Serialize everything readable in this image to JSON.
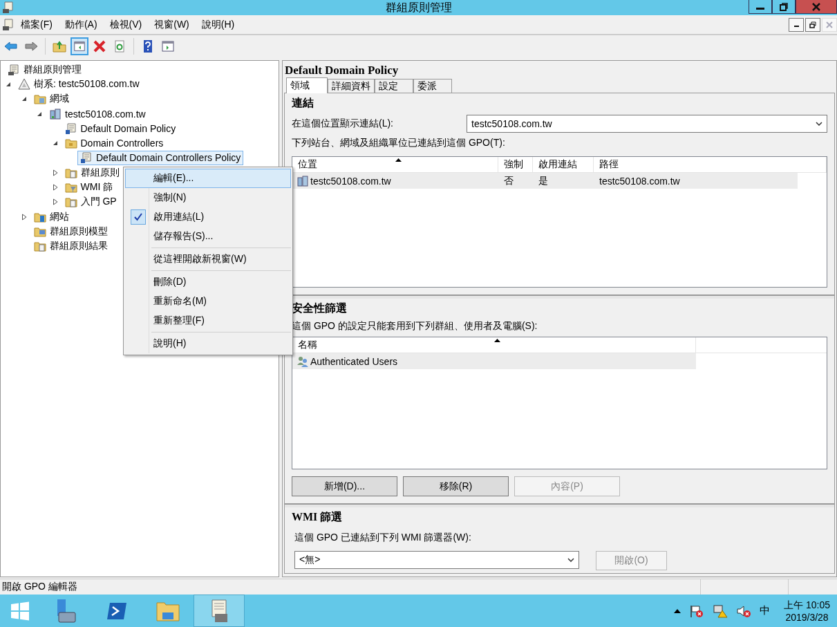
{
  "window": {
    "title": "群組原則管理"
  },
  "menu": [
    "檔案(F)",
    "動作(A)",
    "檢視(V)",
    "視窗(W)",
    "說明(H)"
  ],
  "toolbar": [
    {
      "kind": "back",
      "selected": false
    },
    {
      "kind": "forward",
      "selected": false
    },
    {
      "kind": "separator"
    },
    {
      "kind": "up",
      "selected": false
    },
    {
      "kind": "tree",
      "selected": true
    },
    {
      "kind": "delete",
      "selected": false
    },
    {
      "kind": "refresh",
      "selected": false
    },
    {
      "kind": "separator"
    },
    {
      "kind": "help",
      "selected": false
    },
    {
      "kind": "pane",
      "selected": false
    }
  ],
  "tree": [
    {
      "label": "群組原則管理",
      "kind": "root",
      "selected": false,
      "children": [
        {
          "label": "樹系: testc50108.com.tw",
          "kind": "forest",
          "expanded": true,
          "selected": false,
          "children": [
            {
              "label": "網域",
              "kind": "domains",
              "expanded": true,
              "selected": false,
              "children": [
                {
                  "label": "testc50108.com.tw",
                  "kind": "domain",
                  "expanded": true,
                  "selected": false,
                  "children": [
                    {
                      "label": "Default Domain Policy",
                      "kind": "link",
                      "selected": false
                    },
                    {
                      "label": "Domain Controllers",
                      "kind": "unit",
                      "expanded": true,
                      "selected": false,
                      "children": [
                        {
                          "label": "Default Domain Controllers Policy",
                          "kind": "link",
                          "selected": true
                        }
                      ]
                    },
                    {
                      "label": "群組原則",
                      "kind": "objects",
                      "expanded": false,
                      "selected": false
                    },
                    {
                      "label": "WMI 篩",
                      "kind": "filters",
                      "expanded": false,
                      "selected": false
                    },
                    {
                      "label": "入門 GP",
                      "kind": "starter",
                      "expanded": false,
                      "selected": false
                    }
                  ]
                }
              ]
            },
            {
              "label": "網站",
              "kind": "sites",
              "expanded": false,
              "selected": false
            },
            {
              "label": "群組原則模型",
              "kind": "modeling",
              "selected": false
            },
            {
              "label": "群組原則結果",
              "kind": "results",
              "selected": false
            }
          ]
        }
      ]
    }
  ],
  "context_menu": [
    {
      "kind": "item",
      "label": "編輯(E)...",
      "selected": true,
      "checked": false
    },
    {
      "kind": "item",
      "label": "強制(N)",
      "selected": false,
      "checked": false
    },
    {
      "kind": "item",
      "label": "啟用連結(L)",
      "selected": false,
      "checked": true
    },
    {
      "kind": "item",
      "label": "儲存報告(S)...",
      "selected": false,
      "checked": false
    },
    {
      "kind": "separator"
    },
    {
      "kind": "item",
      "label": "從這裡開啟新視窗(W)",
      "selected": false,
      "checked": false
    },
    {
      "kind": "separator"
    },
    {
      "kind": "item",
      "label": "刪除(D)",
      "selected": false,
      "checked": false
    },
    {
      "kind": "item",
      "label": "重新命名(M)",
      "selected": false,
      "checked": false
    },
    {
      "kind": "item",
      "label": "重新整理(F)",
      "selected": false,
      "checked": false
    },
    {
      "kind": "separator"
    },
    {
      "kind": "item",
      "label": "說明(H)",
      "selected": false,
      "checked": false
    }
  ],
  "details": {
    "title": "Default Domain Policy",
    "tabs": [
      {
        "label": "領域",
        "selected": true
      },
      {
        "label": "詳細資料",
        "selected": false
      },
      {
        "label": "設定",
        "selected": false
      },
      {
        "label": "委派",
        "selected": false
      }
    ],
    "links": {
      "heading": "連結",
      "location_label": "在這個位置顯示連結(L):",
      "location_value": "testc50108.com.tw",
      "description": "下列站台、網域及組織單位已連結到這個 GPO(T):",
      "columns": [
        {
          "label": "位置",
          "sorted": true
        },
        {
          "label": "強制",
          "sorted": false
        },
        {
          "label": "啟用連結",
          "sorted": false
        },
        {
          "label": "路徑",
          "sorted": false
        }
      ],
      "rows": [
        {
          "cells": [
            "testc50108.com.tw",
            "否",
            "是",
            "testc50108.com.tw"
          ],
          "selected": true
        }
      ]
    },
    "security": {
      "heading": "安全性篩選",
      "description": "這個 GPO 的設定只能套用到下列群組、使用者及電腦(S):",
      "columns": [
        {
          "label": "名稱",
          "sorted": true
        }
      ],
      "rows": [
        {
          "cells": [
            "Authenticated Users"
          ],
          "selected": true
        }
      ],
      "buttons": [
        {
          "label": "新增(D)...",
          "disabled": false
        },
        {
          "label": "移除(R)",
          "disabled": false
        },
        {
          "label": "內容(P)",
          "disabled": true
        }
      ]
    },
    "wmi": {
      "heading": "WMI 篩選",
      "description": "這個 GPO 已連結到下列 WMI 篩選器(W):",
      "value": "<無>",
      "button": {
        "label": "開啟(O)",
        "disabled": true
      }
    }
  },
  "status_bar": "開啟 GPO 編輯器",
  "taskbar": {
    "apps": [
      {
        "kind": "server",
        "selected": false
      },
      {
        "kind": "shell",
        "selected": false
      },
      {
        "kind": "explorer",
        "selected": false
      },
      {
        "kind": "gpmc",
        "selected": true
      }
    ],
    "ime": "中",
    "time": "上午 10:05",
    "date": "2019/3/28"
  }
}
